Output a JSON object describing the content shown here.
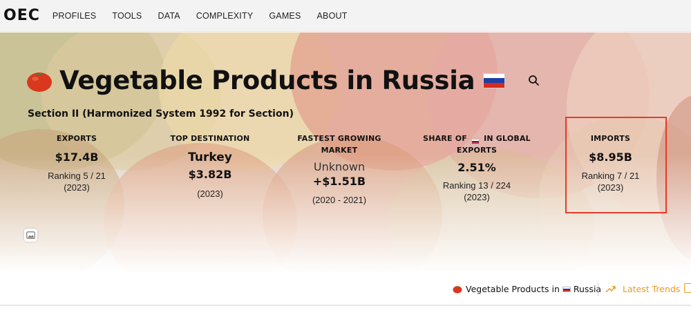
{
  "nav": {
    "logo": "OEC",
    "items": [
      "PROFILES",
      "TOOLS",
      "DATA",
      "COMPLEXITY",
      "GAMES",
      "ABOUT"
    ]
  },
  "hero": {
    "title": "Vegetable Products in Russia",
    "title_icon": "tomato-icon",
    "flag": "russia-flag-icon",
    "subtitle": "Section II (Harmonized System 1992 for Section)",
    "stats": {
      "exports": {
        "label": "EXPORTS",
        "value": "$17.4B",
        "ranking": "Ranking 5 / 21",
        "year": "(2023)"
      },
      "top_destination": {
        "label": "TOP DESTINATION",
        "country": "Turkey",
        "value": "$3.82B",
        "year": "(2023)"
      },
      "fastest_growing": {
        "label_line1": "FASTEST GROWING",
        "label_line2": "MARKET",
        "country": "Unknown",
        "value": "+$1.51B",
        "years": "(2020 - 2021)"
      },
      "share": {
        "label_pre": "SHARE OF",
        "label_post": "IN GLOBAL",
        "label_line2": "EXPORTS",
        "value": "2.51%",
        "ranking": "Ranking 13 / 224",
        "year": "(2023)"
      },
      "imports": {
        "label": "IMPORTS",
        "value": "$8.95B",
        "ranking": "Ranking 7 / 21",
        "year": "(2023)"
      }
    }
  },
  "bottom": {
    "crumb_text": "Vegetable Products in",
    "crumb_country": "Russia",
    "trends_label": "Latest Trends"
  },
  "colors": {
    "accent": "#e89b1c",
    "highlight": "#e43a2a",
    "flag_white": "#ffffff",
    "flag_blue": "#1c3fa8",
    "flag_red": "#d52b1e"
  }
}
